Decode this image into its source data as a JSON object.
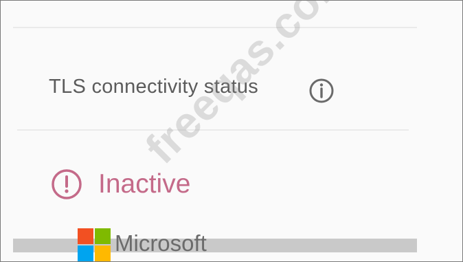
{
  "panel": {
    "section_label": "TLS connectivity status",
    "status_text": "Inactive"
  },
  "icons": {
    "info": "info-circle-icon",
    "status": "exclamation-circle-icon"
  },
  "colors": {
    "status_inactive": "#c46a89",
    "label_text": "#5b5b5b"
  },
  "branding": {
    "logo_text": "Microsoft",
    "watermark": "freeqas.com"
  }
}
